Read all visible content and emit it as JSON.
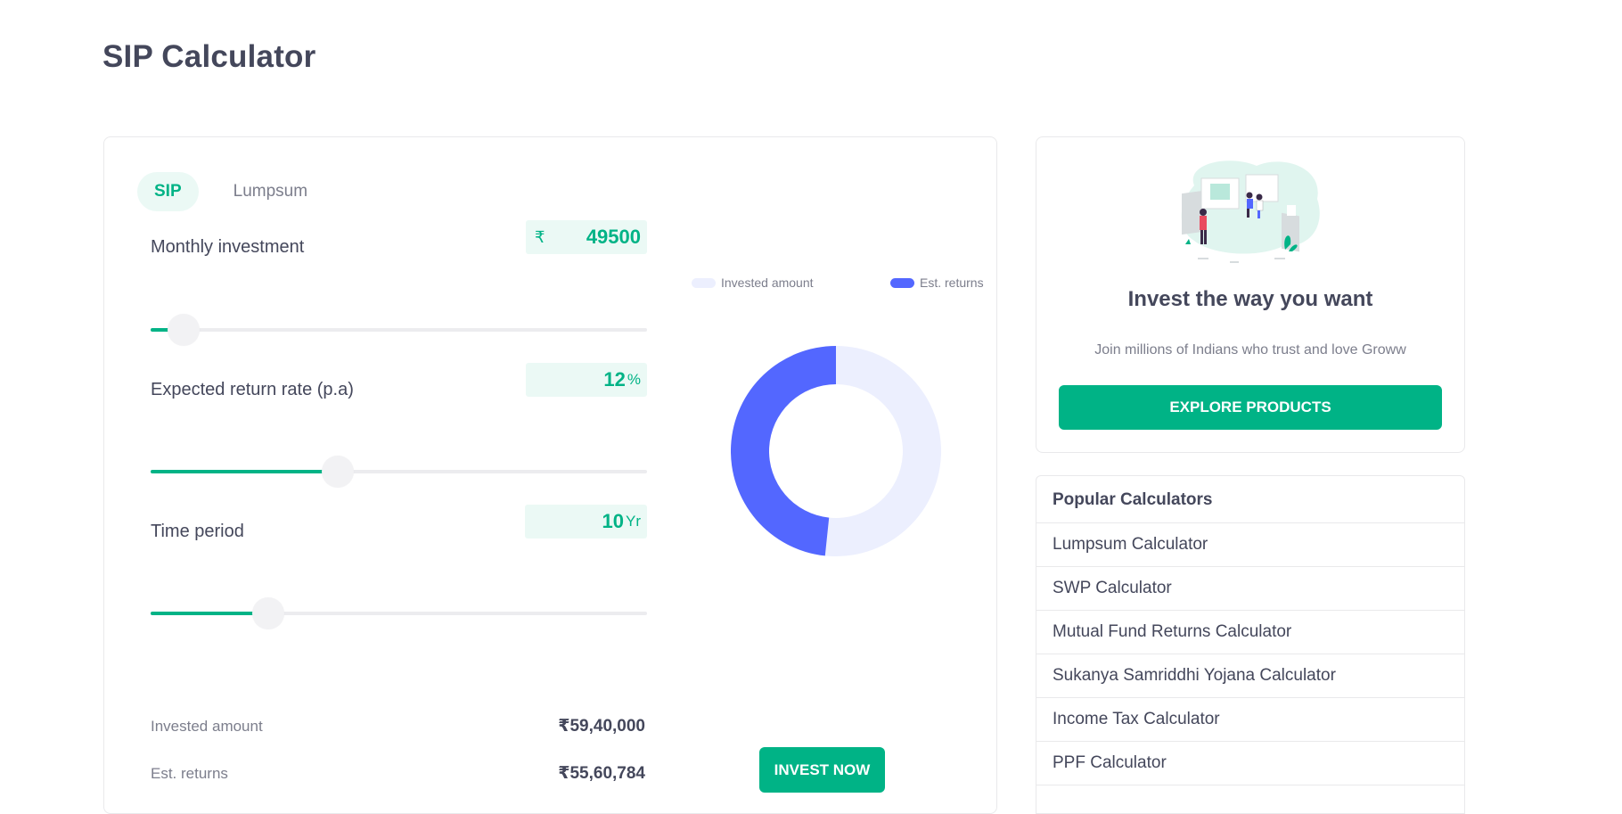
{
  "page": {
    "title": "SIP Calculator"
  },
  "calculator": {
    "tabs": [
      {
        "label": "SIP",
        "active": true
      },
      {
        "label": "Lumpsum",
        "active": false
      }
    ],
    "monthly_investment": {
      "label": "Monthly investment",
      "prefix": "₹",
      "value": "49500",
      "slider_fraction": 0.045
    },
    "return_rate": {
      "label": "Expected return rate (p.a)",
      "value": "12",
      "unit": "%",
      "slider_fraction": 0.355
    },
    "time_period": {
      "label": "Time period",
      "value": "10",
      "unit": "Yr",
      "slider_fraction": 0.215
    },
    "results": {
      "invested_label": "Invested amount",
      "invested_value": "₹59,40,000",
      "returns_label": "Est. returns",
      "returns_value": "₹55,60,784"
    },
    "chart_data": {
      "type": "pie",
      "variant": "donut",
      "legend_placement": "top",
      "series": [
        {
          "name": "Invested amount",
          "value": 5940000,
          "color": "#eceffe"
        },
        {
          "name": "Est. returns",
          "value": 5560784,
          "color": "#5367ff"
        }
      ]
    },
    "invest_button": "INVEST NOW"
  },
  "promo": {
    "title": "Invest the way you want",
    "subtitle": "Join millions of Indians who trust and love Groww",
    "button": "EXPLORE PRODUCTS",
    "illustration": "people-investing-illustration"
  },
  "popular": {
    "title": "Popular Calculators",
    "items": [
      "Lumpsum Calculator",
      "SWP Calculator",
      "Mutual Fund Returns Calculator",
      "Sukanya Samriddhi Yojana Calculator",
      "Income Tax Calculator",
      "PPF Calculator"
    ]
  },
  "colors": {
    "accent": "#00b386",
    "accent_light": "#ebf9f5",
    "returns": "#5367ff",
    "invested": "#eceffe"
  }
}
